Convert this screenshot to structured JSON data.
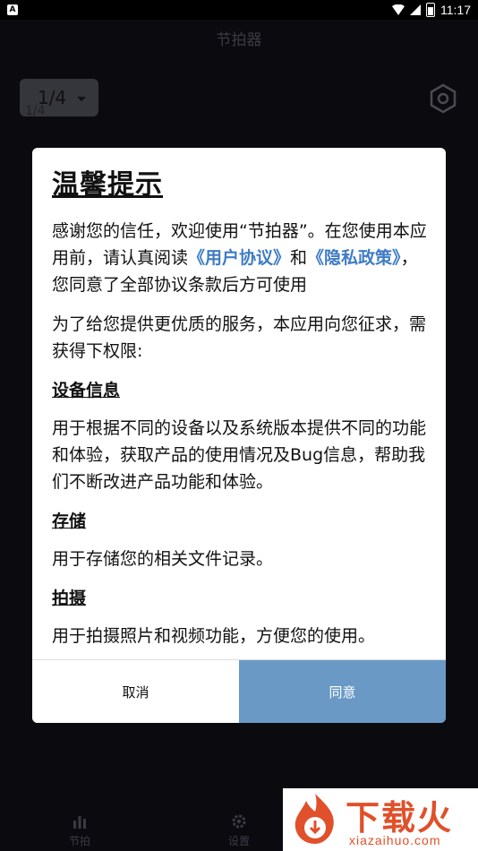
{
  "status_bar": {
    "time": "11:17",
    "left_icon": "A"
  },
  "page": {
    "title": "节拍器",
    "beat_value": "1/4",
    "beat_sub": "1/4"
  },
  "dialog": {
    "title": "温馨提示",
    "intro_part1": "感谢您的信任，欢迎使用“节拍器”。在您使用本应用前，请认真阅读",
    "user_agreement": "《用户协议》",
    "and": "和",
    "privacy_policy": "《隐私政策》",
    "intro_part2": "，您同意了全部协议条款后方可使用",
    "permissions_intro": "为了给您提供更优质的服务，本应用向您征求，需获得下权限:",
    "sections": [
      {
        "title": "设备信息",
        "desc": "用于根据不同的设备以及系统版本提供不同的功能和体验，获取产品的使用情况及Bug信息，帮助我们不断改进产品功能和体验。"
      },
      {
        "title": "存储",
        "desc": "用于存储您的相关文件记录。"
      },
      {
        "title": "拍摄",
        "desc": "用于拍摄照片和视频功能，方便您的使用。"
      }
    ],
    "cancel_label": "取消",
    "agree_label": "同意",
    "accent_color": "#6a99c6"
  },
  "bottom_nav": [
    {
      "label": "节拍",
      "icon": "bar-chart-icon"
    },
    {
      "label": "设置",
      "icon": "gear-icon"
    }
  ],
  "watermark": {
    "text": "下载火",
    "url": "xiazaihuo.com"
  }
}
